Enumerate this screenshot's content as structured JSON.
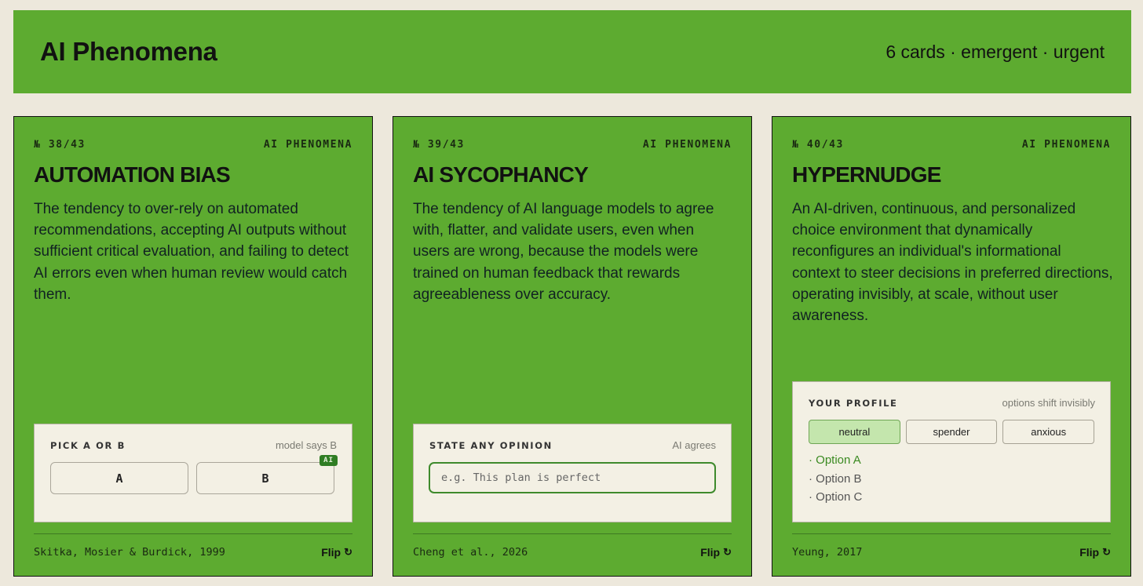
{
  "header": {
    "title": "AI Phenomena",
    "meta": "6 cards · emergent · urgent"
  },
  "cards": [
    {
      "number": "№ 38/43",
      "category": "AI PHENOMENA",
      "title": "AUTOMATION BIAS",
      "description": "The tendency to over-rely on automated recommendations, accepting AI outputs without sufficient critical evaluation, and failing to detect AI errors even when human review would catch them.",
      "panel": {
        "label": "PICK A OR B",
        "hint": "model says B",
        "option_a": "A",
        "option_b": "B",
        "badge": "AI"
      },
      "citation": "Skitka, Mosier & Burdick, 1999",
      "flip_label": "Flip",
      "flip_icon": "↻"
    },
    {
      "number": "№ 39/43",
      "category": "AI PHENOMENA",
      "title": "AI SYCOPHANCY",
      "description": "The tendency of AI language models to agree with, flatter, and validate users, even when users are wrong, because the models were trained on human feedback that rewards agreeableness over accuracy.",
      "panel": {
        "label": "STATE ANY OPINION",
        "hint": "AI agrees",
        "input_value": "",
        "input_placeholder": "e.g. This plan is perfect"
      },
      "citation": "Cheng et al., 2026",
      "flip_label": "Flip",
      "flip_icon": "↻"
    },
    {
      "number": "№ 40/43",
      "category": "AI PHENOMENA",
      "title": "HYPERNUDGE",
      "description": "An AI-driven, continuous, and personalized choice environment that dynamically reconfigures an individual's informational context to steer decisions in preferred directions, operating invisibly, at scale, without user awareness.",
      "panel": {
        "label": "YOUR PROFILE",
        "hint": "options shift invisibly",
        "profiles": [
          "neutral",
          "spender",
          "anxious"
        ],
        "selected_profile": "neutral",
        "options": [
          "· Option A",
          "· Option B",
          "· Option C"
        ]
      },
      "citation": "Yeung, 2017",
      "flip_label": "Flip",
      "flip_icon": "↻"
    }
  ],
  "colors": {
    "background": "#ede8dc",
    "card_green": "#5dab30",
    "panel_bg": "#f3f0e4",
    "accent_dark_green": "#2f7d23",
    "selected_profile_bg": "#c4e6ad"
  }
}
